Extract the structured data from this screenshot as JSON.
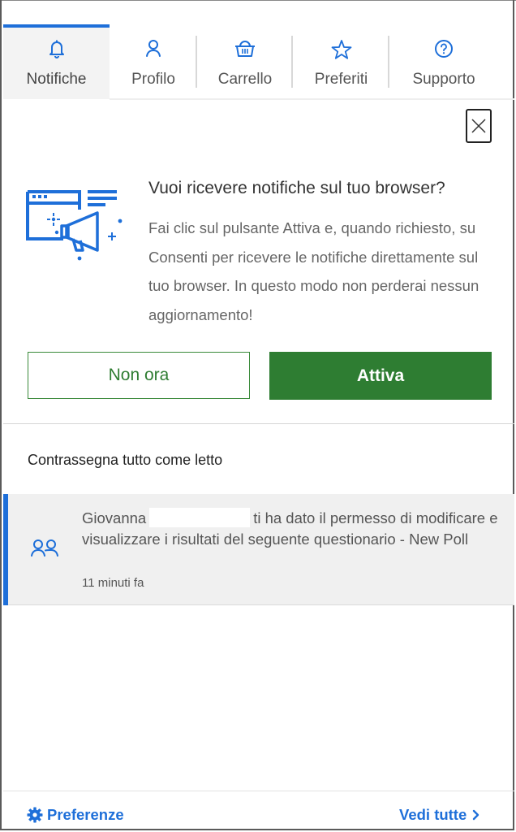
{
  "colors": {
    "accent_blue": "#1e6fd9",
    "green": "#2e7d32",
    "unread_bg": "#f0f0f0"
  },
  "tabs": [
    {
      "label": "Notifiche",
      "icon": "bell-icon",
      "active": true
    },
    {
      "label": "Profilo",
      "icon": "user-icon",
      "active": false
    },
    {
      "label": "Carrello",
      "icon": "basket-icon",
      "active": false
    },
    {
      "label": "Preferiti",
      "icon": "star-icon",
      "active": false
    },
    {
      "label": "Supporto",
      "icon": "help-icon",
      "active": false
    }
  ],
  "promo": {
    "title": "Vuoi ricevere notifiche sul tuo browser?",
    "text": "Fai clic sul pulsante Attiva e, quando richiesto, su Consenti per ricevere le notifiche direttamente sul tuo browser. In questo modo non perderai nessun aggiornamento!",
    "later_label": "Non ora",
    "enable_label": "Attiva"
  },
  "mark_all_label": "Contrassegna tutto come letto",
  "notifications": [
    {
      "sender": "Giovanna",
      "message": "ti ha dato il permesso di modificare e visualizzare i risultati del seguente questionario - New Poll",
      "time": "11 minuti fa",
      "unread": true
    }
  ],
  "footer": {
    "preferences_label": "Preferenze",
    "view_all_label": "Vedi tutte"
  }
}
